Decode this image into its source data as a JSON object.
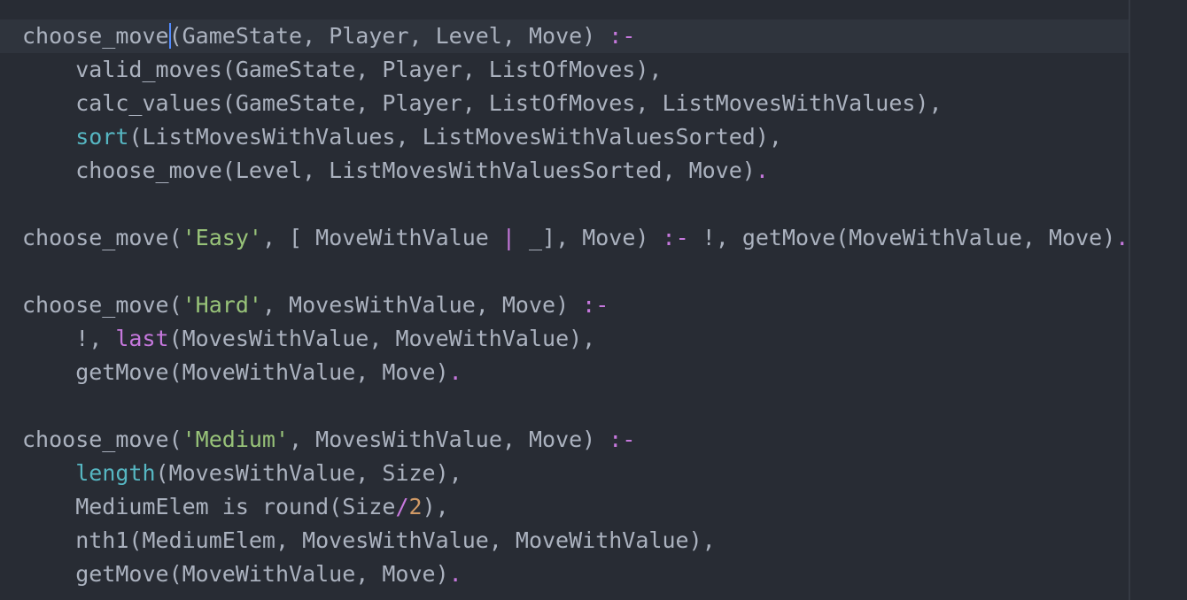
{
  "colors": {
    "background": "#282c34",
    "current_line": "#2f343d",
    "cursor": "#528bff",
    "plain": "#abb2bf",
    "operator": "#c678dd",
    "string": "#98c379",
    "builtin": "#56b6c2",
    "number": "#d19a66"
  },
  "code": {
    "lines": [
      [
        {
          "t": "choose_move",
          "c": "plain"
        },
        {
          "cursor": true
        },
        {
          "t": "(GameState, Player, Level, Move) ",
          "c": "plain"
        },
        {
          "t": ":-",
          "c": "op"
        }
      ],
      [
        {
          "t": "    valid_moves(GameState, Player, ListOfMoves),",
          "c": "plain"
        }
      ],
      [
        {
          "t": "    calc_values(GameState, Player, ListOfMoves, ListMovesWithValues),",
          "c": "plain"
        }
      ],
      [
        {
          "t": "    ",
          "c": "plain"
        },
        {
          "t": "sort",
          "c": "builtin"
        },
        {
          "t": "(ListMovesWithValues, ListMovesWithValuesSorted),",
          "c": "plain"
        }
      ],
      [
        {
          "t": "    choose_move(Level, ListMovesWithValuesSorted, Move)",
          "c": "plain"
        },
        {
          "t": ".",
          "c": "op"
        }
      ],
      [],
      [
        {
          "t": "choose_move(",
          "c": "plain"
        },
        {
          "t": "'Easy'",
          "c": "str"
        },
        {
          "t": ", [ MoveWithValue ",
          "c": "plain"
        },
        {
          "t": "|",
          "c": "op"
        },
        {
          "t": " _], Move) ",
          "c": "plain"
        },
        {
          "t": ":-",
          "c": "op"
        },
        {
          "t": " !, getMove(MoveWithValue, Move)",
          "c": "plain"
        },
        {
          "t": ".",
          "c": "op"
        }
      ],
      [],
      [
        {
          "t": "choose_move(",
          "c": "plain"
        },
        {
          "t": "'Hard'",
          "c": "str"
        },
        {
          "t": ", MovesWithValue, Move) ",
          "c": "plain"
        },
        {
          "t": ":-",
          "c": "op"
        }
      ],
      [
        {
          "t": "    !, ",
          "c": "plain"
        },
        {
          "t": "last",
          "c": "op"
        },
        {
          "t": "(MovesWithValue, MoveWithValue),",
          "c": "plain"
        }
      ],
      [
        {
          "t": "    getMove(MoveWithValue, Move)",
          "c": "plain"
        },
        {
          "t": ".",
          "c": "op"
        }
      ],
      [],
      [
        {
          "t": "choose_move(",
          "c": "plain"
        },
        {
          "t": "'Medium'",
          "c": "str"
        },
        {
          "t": ", MovesWithValue, Move) ",
          "c": "plain"
        },
        {
          "t": ":-",
          "c": "op"
        }
      ],
      [
        {
          "t": "    ",
          "c": "plain"
        },
        {
          "t": "length",
          "c": "builtin"
        },
        {
          "t": "(MovesWithValue, Size),",
          "c": "plain"
        }
      ],
      [
        {
          "t": "    MediumElem is round(Size",
          "c": "plain"
        },
        {
          "t": "/",
          "c": "op"
        },
        {
          "t": "2",
          "c": "num"
        },
        {
          "t": "),",
          "c": "plain"
        }
      ],
      [
        {
          "t": "    nth1(MediumElem, MovesWithValue, MoveWithValue),",
          "c": "plain"
        }
      ],
      [
        {
          "t": "    getMove(MoveWithValue, Move)",
          "c": "plain"
        },
        {
          "t": ".",
          "c": "op"
        }
      ]
    ]
  }
}
